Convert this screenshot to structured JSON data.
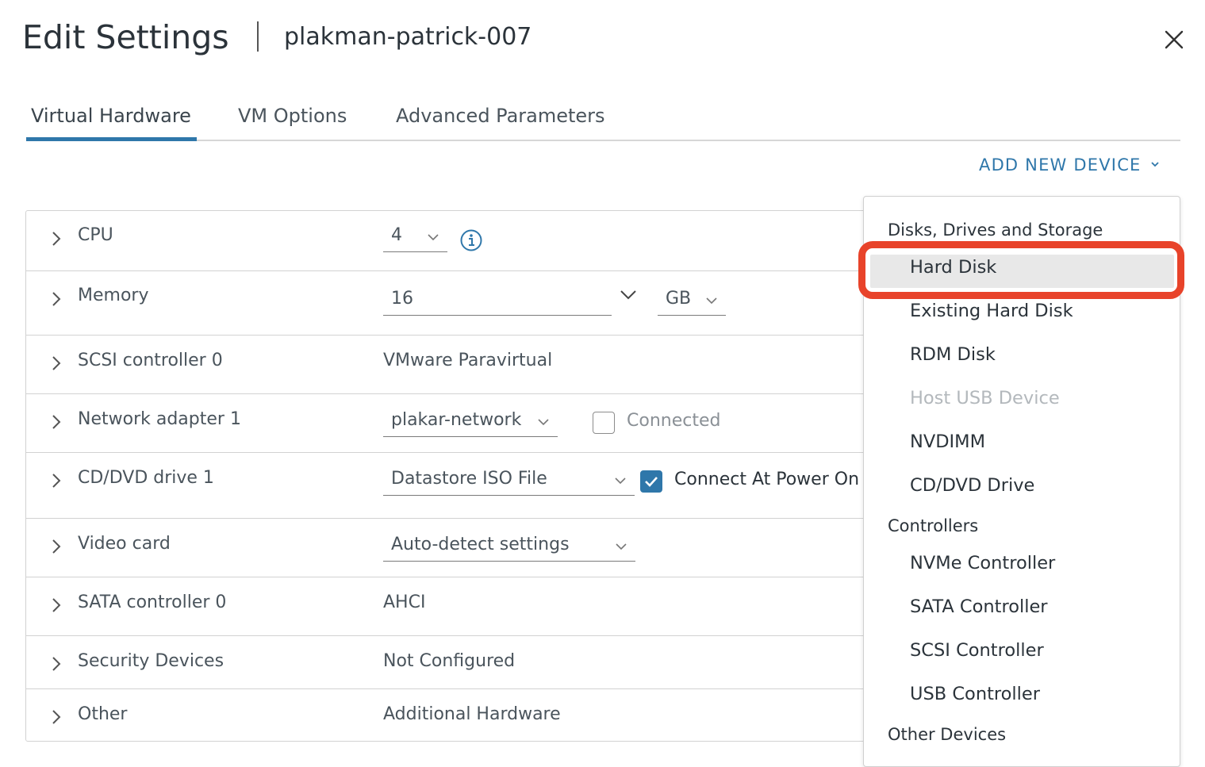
{
  "dialog": {
    "title": "Edit Settings",
    "vm_name": "plakman-patrick-007"
  },
  "tabs": [
    {
      "label": "Virtual Hardware",
      "active": true
    },
    {
      "label": "VM Options",
      "active": false
    },
    {
      "label": "Advanced Parameters",
      "active": false
    }
  ],
  "add_device": {
    "label": "ADD NEW DEVICE"
  },
  "hardware": {
    "cpu": {
      "label": "CPU",
      "value": "4"
    },
    "memory": {
      "label": "Memory",
      "value": "16",
      "unit": "GB"
    },
    "scsi": {
      "label": "SCSI controller 0",
      "value": "VMware Paravirtual"
    },
    "network": {
      "label": "Network adapter 1",
      "value": "plakar-network",
      "connected_label": "Connected",
      "connected": false
    },
    "cddvd": {
      "label": "CD/DVD drive 1",
      "value": "Datastore ISO File",
      "connect_label": "Connect At Power On",
      "connect": true
    },
    "video": {
      "label": "Video card",
      "value": "Auto-detect settings"
    },
    "sata": {
      "label": "SATA controller 0",
      "value": "AHCI"
    },
    "security": {
      "label": "Security Devices",
      "value": "Not Configured"
    },
    "other": {
      "label": "Other",
      "value": "Additional Hardware"
    }
  },
  "menu": {
    "sections": [
      {
        "header": "Disks, Drives and Storage",
        "items": [
          "Hard Disk",
          "Existing Hard Disk",
          "RDM Disk",
          "Host USB Device",
          "NVDIMM",
          "CD/DVD Drive"
        ]
      },
      {
        "header": "Controllers",
        "items": [
          "NVMe Controller",
          "SATA Controller",
          "SCSI Controller",
          "USB Controller"
        ]
      },
      {
        "header": "Other Devices",
        "items": []
      }
    ],
    "disabled_item": "Host USB Device",
    "highlighted_item": "Hard Disk"
  },
  "colors": {
    "accent": "#2f77aa",
    "highlight_outline": "#e8432a"
  }
}
